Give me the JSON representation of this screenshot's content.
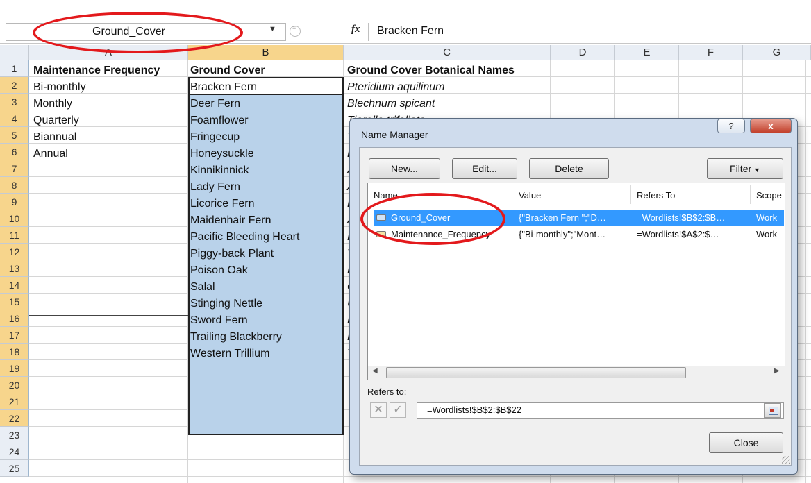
{
  "formula_bar": {
    "name_box": "Ground_Cover",
    "fx_label": "fx",
    "formula": "Bracken Fern"
  },
  "columns": [
    "A",
    "B",
    "C",
    "D",
    "E",
    "F",
    "G"
  ],
  "rows": [
    "1",
    "2",
    "3",
    "4",
    "5",
    "6",
    "7",
    "8",
    "9",
    "10",
    "11",
    "12",
    "13",
    "14",
    "15",
    "16",
    "17",
    "18",
    "19",
    "20",
    "21",
    "22",
    "23",
    "24",
    "25"
  ],
  "sheet": {
    "headers": {
      "A1": "Maintenance Frequency",
      "B1": "Ground Cover",
      "C1": "Ground Cover Botanical Names"
    },
    "col_a": [
      "Bi-monthly",
      "Monthly",
      "Quarterly",
      "Biannual",
      "Annual"
    ],
    "col_b": [
      "Bracken Fern",
      "Deer Fern",
      "Foamflower",
      "Fringecup",
      "Honeysuckle",
      "Kinnikinnick",
      "Lady Fern",
      "Licorice Fern",
      "Maidenhair Fern",
      "Pacific Bleeding Heart",
      "Piggy-back Plant",
      "Poison Oak",
      "Salal",
      "Stinging Nettle",
      "Sword Fern",
      "Trailing Blackberry",
      "Western Trillium"
    ],
    "col_c": [
      "Pteridium aquilinum",
      "Blechnum spicant",
      "Tiarella trifoliata"
    ],
    "col_c_clipped": [
      "T",
      "L",
      "A",
      "A",
      "F",
      "A",
      "D",
      "T",
      "R",
      "G",
      "U",
      "P",
      "R",
      "T"
    ]
  },
  "dialog": {
    "title": "Name Manager",
    "help": "?",
    "close_x": "x",
    "buttons": {
      "new": "New...",
      "edit": "Edit...",
      "delete": "Delete",
      "filter": "Filter"
    },
    "list_headers": {
      "name": "Name",
      "value": "Value",
      "refers_to": "Refers To",
      "scope": "Scope"
    },
    "items": [
      {
        "name": "Ground_Cover",
        "value": "{\"Bracken Fern \";\"D…",
        "refers_to": "=Wordlists!$B$2:$B…",
        "scope": "Work"
      },
      {
        "name": "Maintenance_Frequency",
        "value": "{\"Bi-monthly\";\"Mont…",
        "refers_to": "=Wordlists!$A$2:$…",
        "scope": "Work"
      }
    ],
    "refers_to_label": "Refers to:",
    "refers_to_value": "=Wordlists!$B$2:$B$22",
    "close_button": "Close"
  },
  "accent_colors": {
    "selection_fill": "#b9d2ea",
    "header_highlight": "#f7d58c",
    "list_selection": "#3399ff",
    "annotation_ring": "#e3191c"
  }
}
